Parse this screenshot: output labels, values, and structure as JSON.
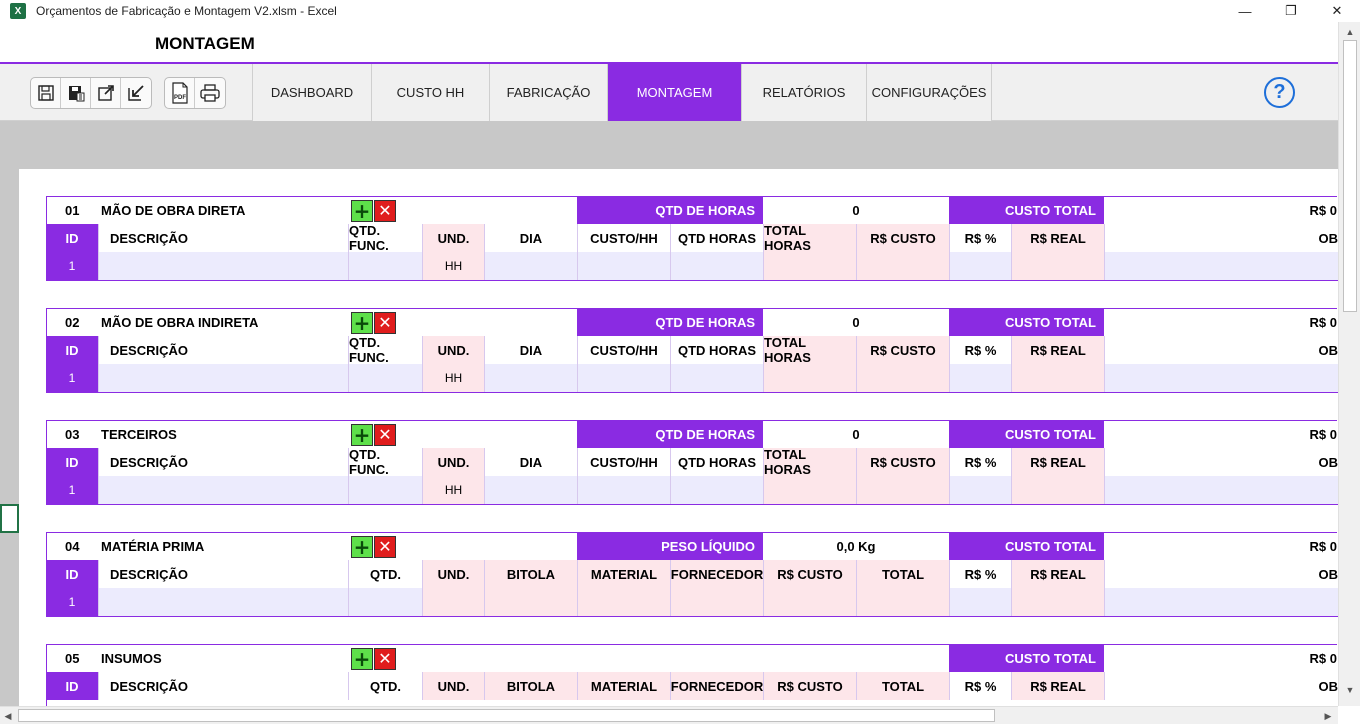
{
  "window": {
    "title": "Orçamentos de Fabricação e Montagem V2.xlsm  -  Excel",
    "app_icon_letter": "X",
    "minimize": "—",
    "restore": "❐",
    "close": "✕"
  },
  "page": {
    "title": "MONTAGEM"
  },
  "toolbar": {
    "icons": [
      "save-icon",
      "save-as-icon",
      "expand-icon",
      "collapse-icon",
      "pdf-icon",
      "print-icon"
    ],
    "pdf_label": "PDF"
  },
  "tabs": [
    {
      "label": "DASHBOARD",
      "active": false
    },
    {
      "label": "CUSTO HH",
      "active": false
    },
    {
      "label": "FABRICAÇÃO",
      "active": false
    },
    {
      "label": "MONTAGEM",
      "active": true
    },
    {
      "label": "RELATÓRIOS",
      "active": false
    },
    {
      "label": "CONFIGURAÇÕES",
      "active": false
    }
  ],
  "help_label": "?",
  "buttons": {
    "add": "+",
    "delete": "✕"
  },
  "colors": {
    "accent": "#8a2be2",
    "pink_cell": "#fde6ea",
    "lavender_cell": "#ecebfd",
    "add_green": "#5ee04a",
    "delete_red": "#e01d1d",
    "help_blue": "#1e6fd9"
  },
  "sections": [
    {
      "num": "01",
      "name": "MÃO DE OBRA DIRETA",
      "metric_label": "QTD DE HORAS",
      "metric_value": "0",
      "total_label": "CUSTO TOTAL",
      "total_value": "R$ 0",
      "headers": [
        "ID",
        "DESCRIÇÃO",
        "QTD. FUNC.",
        "UND.",
        "DIA",
        "CUSTO/HH",
        "QTD HORAS",
        "TOTAL HORAS",
        "R$ CUSTO",
        "R$ %",
        "R$ REAL",
        "OB"
      ],
      "row": {
        "id": "1",
        "und": "HH"
      }
    },
    {
      "num": "02",
      "name": "MÃO DE OBRA INDIRETA",
      "metric_label": "QTD DE HORAS",
      "metric_value": "0",
      "total_label": "CUSTO TOTAL",
      "total_value": "R$ 0",
      "headers": [
        "ID",
        "DESCRIÇÃO",
        "QTD. FUNC.",
        "UND.",
        "DIA",
        "CUSTO/HH",
        "QTD HORAS",
        "TOTAL HORAS",
        "R$ CUSTO",
        "R$ %",
        "R$ REAL",
        "OB"
      ],
      "row": {
        "id": "1",
        "und": "HH"
      }
    },
    {
      "num": "03",
      "name": "TERCEIROS",
      "metric_label": "QTD DE HORAS",
      "metric_value": "0",
      "total_label": "CUSTO TOTAL",
      "total_value": "R$ 0",
      "headers": [
        "ID",
        "DESCRIÇÃO",
        "QTD. FUNC.",
        "UND.",
        "DIA",
        "CUSTO/HH",
        "QTD HORAS",
        "TOTAL HORAS",
        "R$ CUSTO",
        "R$ %",
        "R$ REAL",
        "OB"
      ],
      "row": {
        "id": "1",
        "und": "HH"
      }
    },
    {
      "num": "04",
      "name": "MATÉRIA PRIMA",
      "metric_label": "PESO LÍQUIDO",
      "metric_value": "0,0 Kg",
      "total_label": "CUSTO TOTAL",
      "total_value": "R$ 0",
      "headers": [
        "ID",
        "DESCRIÇÃO",
        "QTD.",
        "UND.",
        "BITOLA",
        "MATERIAL",
        "FORNECEDOR",
        "R$ CUSTO",
        "TOTAL",
        "R$ %",
        "R$ REAL",
        "OB"
      ],
      "row": {
        "id": "1",
        "und": ""
      }
    },
    {
      "num": "05",
      "name": "INSUMOS",
      "metric_label": "",
      "metric_value": "",
      "total_label": "CUSTO TOTAL",
      "total_value": "R$ 0",
      "headers": [
        "ID",
        "DESCRIÇÃO",
        "QTD.",
        "UND.",
        "BITOLA",
        "MATERIAL",
        "FORNECEDOR",
        "R$ CUSTO",
        "TOTAL",
        "R$ %",
        "R$ REAL",
        "OB"
      ],
      "row": {
        "id": "",
        "und": ""
      }
    }
  ],
  "scroll": {
    "up": "▲",
    "down": "▼",
    "left": "◀",
    "right": "▶"
  }
}
